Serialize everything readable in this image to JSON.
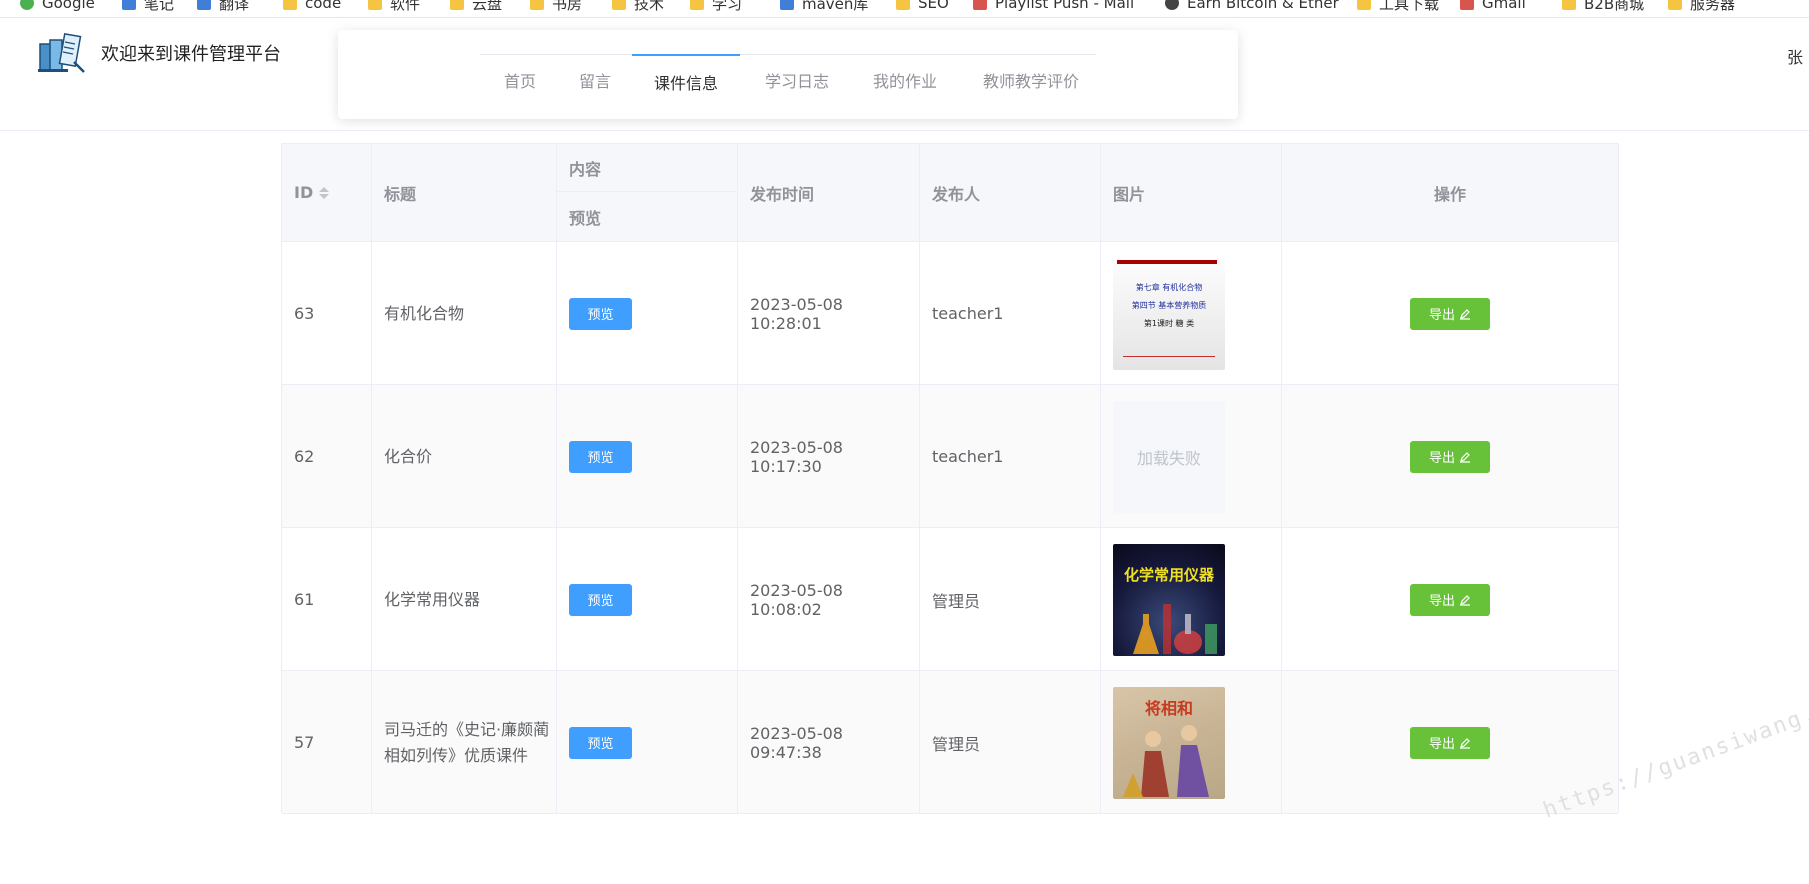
{
  "bookmarks": [
    {
      "label": "Google",
      "icon": "google-icon"
    },
    {
      "label": "笔记",
      "icon": "bookmark-icon"
    },
    {
      "label": "翻译",
      "icon": "translate-icon"
    },
    {
      "label": "code",
      "icon": "folder-icon"
    },
    {
      "label": "软件",
      "icon": "folder-icon"
    },
    {
      "label": "云盘",
      "icon": "folder-icon"
    },
    {
      "label": "书房",
      "icon": "folder-icon"
    },
    {
      "label": "技术",
      "icon": "folder-icon"
    },
    {
      "label": "学习",
      "icon": "folder-icon"
    },
    {
      "label": "maven库",
      "icon": "maven-icon"
    },
    {
      "label": "SEO",
      "icon": "folder-icon"
    },
    {
      "label": "Playlist Push - Mail",
      "icon": "playlist-icon"
    },
    {
      "label": "Earn Bitcoin & Ether",
      "icon": "bitcoin-icon"
    },
    {
      "label": "工具下载",
      "icon": "folder-icon"
    },
    {
      "label": "Gmail",
      "icon": "gmail-icon"
    },
    {
      "label": "B2B商城",
      "icon": "folder-icon"
    },
    {
      "label": "服务器",
      "icon": "folder-icon"
    }
  ],
  "header": {
    "site_title": "欢迎来到课件管理平台",
    "user_name": "张",
    "logo_icon": "books-icon"
  },
  "nav": {
    "items": [
      {
        "label": "首页",
        "active": false
      },
      {
        "label": "留言",
        "active": false
      },
      {
        "label": "课件信息",
        "active": true
      },
      {
        "label": "学习日志",
        "active": false
      },
      {
        "label": "我的作业",
        "active": false
      },
      {
        "label": "教师教学评价",
        "active": false
      }
    ]
  },
  "table": {
    "headers": {
      "id": "ID",
      "title": "标题",
      "content_group": "内容",
      "preview": "预览",
      "publish_time": "发布时间",
      "publisher": "发布人",
      "image": "图片",
      "actions": "操作"
    },
    "preview_label": "预览",
    "export_label": "导出",
    "image_failed_label": "加载失败",
    "rows": [
      {
        "id": "63",
        "title": "有机化合物",
        "publish_time": "2023-05-08 10:28:01",
        "publisher": "teacher1",
        "image": "slide"
      },
      {
        "id": "62",
        "title": "化合价",
        "publish_time": "2023-05-08 10:17:30",
        "publisher": "teacher1",
        "image": "failed"
      },
      {
        "id": "61",
        "title": "化学常用仪器",
        "publish_time": "2023-05-08 10:08:02",
        "publisher": "管理员",
        "image": "lab"
      },
      {
        "id": "57",
        "title": "司马迁的《史记·廉颇蔺相如列传》优质课件",
        "publish_time": "2023-05-08 09:47:38",
        "publisher": "管理员",
        "image": "painting"
      }
    ]
  },
  "thumbs": {
    "slide_line1": "第七章 有机化合物",
    "slide_line2": "第四节 基本营养物质",
    "slide_line3": "第1课时 糖 类",
    "lab_title": "化学常用仪器",
    "painting_title": "将相和"
  },
  "watermark": "https://guansiwang.com",
  "colors": {
    "primary": "#409eff",
    "success": "#67c23a",
    "header_bg": "#f5f7fa"
  }
}
